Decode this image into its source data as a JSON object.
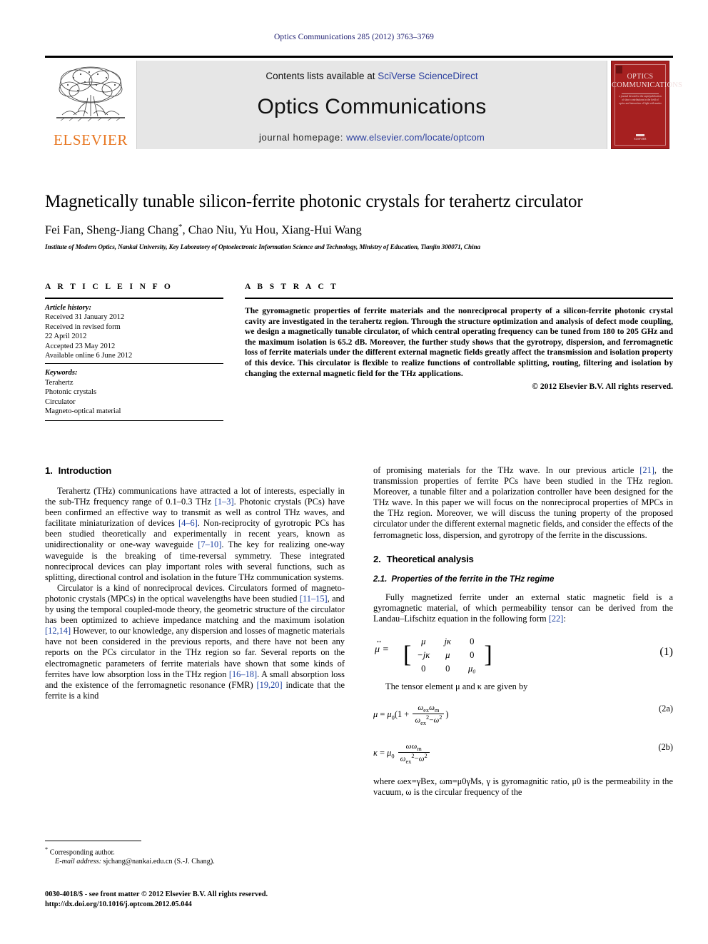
{
  "running_head": "Optics Communications 285 (2012) 3763–3769",
  "masthead": {
    "contents_prefix": "Contents lists available at ",
    "contents_link": "SciVerse ScienceDirect",
    "journal_name": "Optics Communications",
    "homepage_prefix": "journal homepage: ",
    "homepage_link": "www.elsevier.com/locate/optcom",
    "publisher_wordmark": "ELSEVIER",
    "publisher_color": "#e87722",
    "link_color": "#2b3f9e",
    "cover": {
      "line1": "OPTICS",
      "line2": "COMMUNICATIONS",
      "subtitle": "a journal devoted to the rapid publication of short contributions in the field of optics and interaction of light with matter",
      "footer": "ELSEVIER",
      "background_color": "#a62020"
    }
  },
  "title": "Magnetically tunable silicon-ferrite photonic crystals for terahertz circulator",
  "authors": "Fei Fan, Sheng-Jiang Chang",
  "authors_tail": ", Chao Niu, Yu Hou, Xiang-Hui Wang",
  "corresponding_marker": "*",
  "affiliation": "Institute of Modern Optics, Nankai University, Key Laboratory of Optoelectronic Information Science and Technology, Ministry of Education, Tianjin 300071, China",
  "article_info": {
    "heading": "A R T I C L E   I N F O",
    "history_label": "Article history:",
    "history": [
      "Received 31 January 2012",
      "Received in revised form",
      "22 April 2012",
      "Accepted 23 May 2012",
      "Available online 6 June 2012"
    ],
    "keywords_label": "Keywords:",
    "keywords": [
      "Terahertz",
      "Photonic crystals",
      "Circulator",
      "Magneto-optical material"
    ]
  },
  "abstract": {
    "heading": "A B S T R A C T",
    "text": "The gyromagnetic properties of ferrite materials and the nonreciprocal property of a silicon-ferrite photonic crystal cavity are investigated in the terahertz region. Through the structure optimization and analysis of defect mode coupling, we design a magnetically tunable circulator, of which central operating frequency can be tuned from 180 to 205 GHz and the maximum isolation is 65.2 dB. Moreover, the further study shows that the gyrotropy, dispersion, and ferromagnetic loss of ferrite materials under the different external magnetic fields greatly affect the transmission and isolation property of this device. This circulator is flexible to realize functions of controllable splitting, routing, filtering and isolation by changing the external magnetic field for the THz applications.",
    "copyright": "© 2012 Elsevier B.V. All rights reserved."
  },
  "sections": {
    "intro_number": "1.",
    "intro_title": "Introduction",
    "intro_p1_a": "Terahertz (THz) communications have attracted a lot of interests, especially in the sub-THz frequency range of 0.1–0.3 THz ",
    "intro_p1_r1": "[1–3]",
    "intro_p1_b": ". Photonic crystals (PCs) have been confirmed an effective way to transmit as well as control THz waves, and facilitate miniaturization of devices ",
    "intro_p1_r2": "[4–6]",
    "intro_p1_c": ". Non-reciprocity of gyrotropic PCs has been studied theoretically and experimentally in recent years, known as unidirectionality or one-way waveguide ",
    "intro_p1_r3": "[7–10]",
    "intro_p1_d": ". The key for realizing one-way waveguide is the breaking of time-reversal symmetry. These integrated nonreciprocal devices can play important roles with several functions, such as splitting, directional control and isolation in the future THz communication systems.",
    "intro_p2_a": "Circulator is a kind of nonreciprocal devices. Circulators formed of magneto-photonic crystals (MPCs) in the optical wavelengths have been studied ",
    "intro_p2_r1": "[11–15]",
    "intro_p2_b": ", and by using the temporal coupled-mode theory, the geometric structure of the circulator has been optimized to achieve impedance matching and the maximum isolation ",
    "intro_p2_r2": "[12,14]",
    "intro_p2_c": " However, to our knowledge, any dispersion and losses of magnetic materials have not been considered in the previous reports, and there have not been any reports on the PCs circulator in the THz region so far. Several reports on the electromagnetic parameters of ferrite materials have shown that some kinds of ferrites have low absorption loss in the THz region ",
    "intro_p2_r3": "[16–18]",
    "intro_p2_d": ". A small absorption loss and the existence of the ferromagnetic resonance (FMR) ",
    "intro_p2_r4": "[19,20]",
    "intro_p2_e": " indicate that the ferrite is a kind",
    "intro_p3_a": "of promising materials for the THz wave. In our previous article ",
    "intro_p3_r1": "[21]",
    "intro_p3_b": ", the transmission properties of ferrite PCs have been studied in the THz region. Moreover, a tunable filter and a polarization controller have been designed for the THz wave. In this paper we will focus on the nonreciprocal properties of MPCs in the THz region. Moreover, we will discuss the tuning property of the proposed circulator under the different external magnetic fields, and consider the effects of the ferromagnetic loss, dispersion, and gyrotropy of the ferrite in the discussions.",
    "theory_number": "2.",
    "theory_title": "Theoretical analysis",
    "sub21_number": "2.1.",
    "sub21_title": "Properties of the ferrite in the THz regime",
    "theory_p1_a": "Fully magnetized ferrite under an external static magnetic field is a gyromagnetic material, of which permeability tensor can be derived from the Landau–Lifschitz equation in the following form ",
    "theory_p1_r1": "[22]",
    "theory_p1_b": ":",
    "eq1_number": "(1)",
    "eq1_cells": [
      "μ",
      "jκ",
      "0",
      "−jκ",
      "μ",
      "0",
      "0",
      "0",
      "μ₀"
    ],
    "tensor_line": "The tensor element μ and κ are given by",
    "eq2a_number": "(2a)",
    "eq2b_number": "(2b)",
    "where_line": "where ωex=γBex, ωm=μ0γMs, γ is gyromagnitic ratio, μ0 is the permeability in the vacuum, ω is the circular frequency of the"
  },
  "footnote": {
    "corresponding": "Corresponding author.",
    "email_label": "E-mail address:",
    "email": "sjchang@nankai.edu.cn (S.-J. Chang)."
  },
  "imprint": {
    "line1": "0030-4018/$ - see front matter © 2012 Elsevier B.V. All rights reserved.",
    "line2": "http://dx.doi.org/10.1016/j.optcom.2012.05.044"
  }
}
